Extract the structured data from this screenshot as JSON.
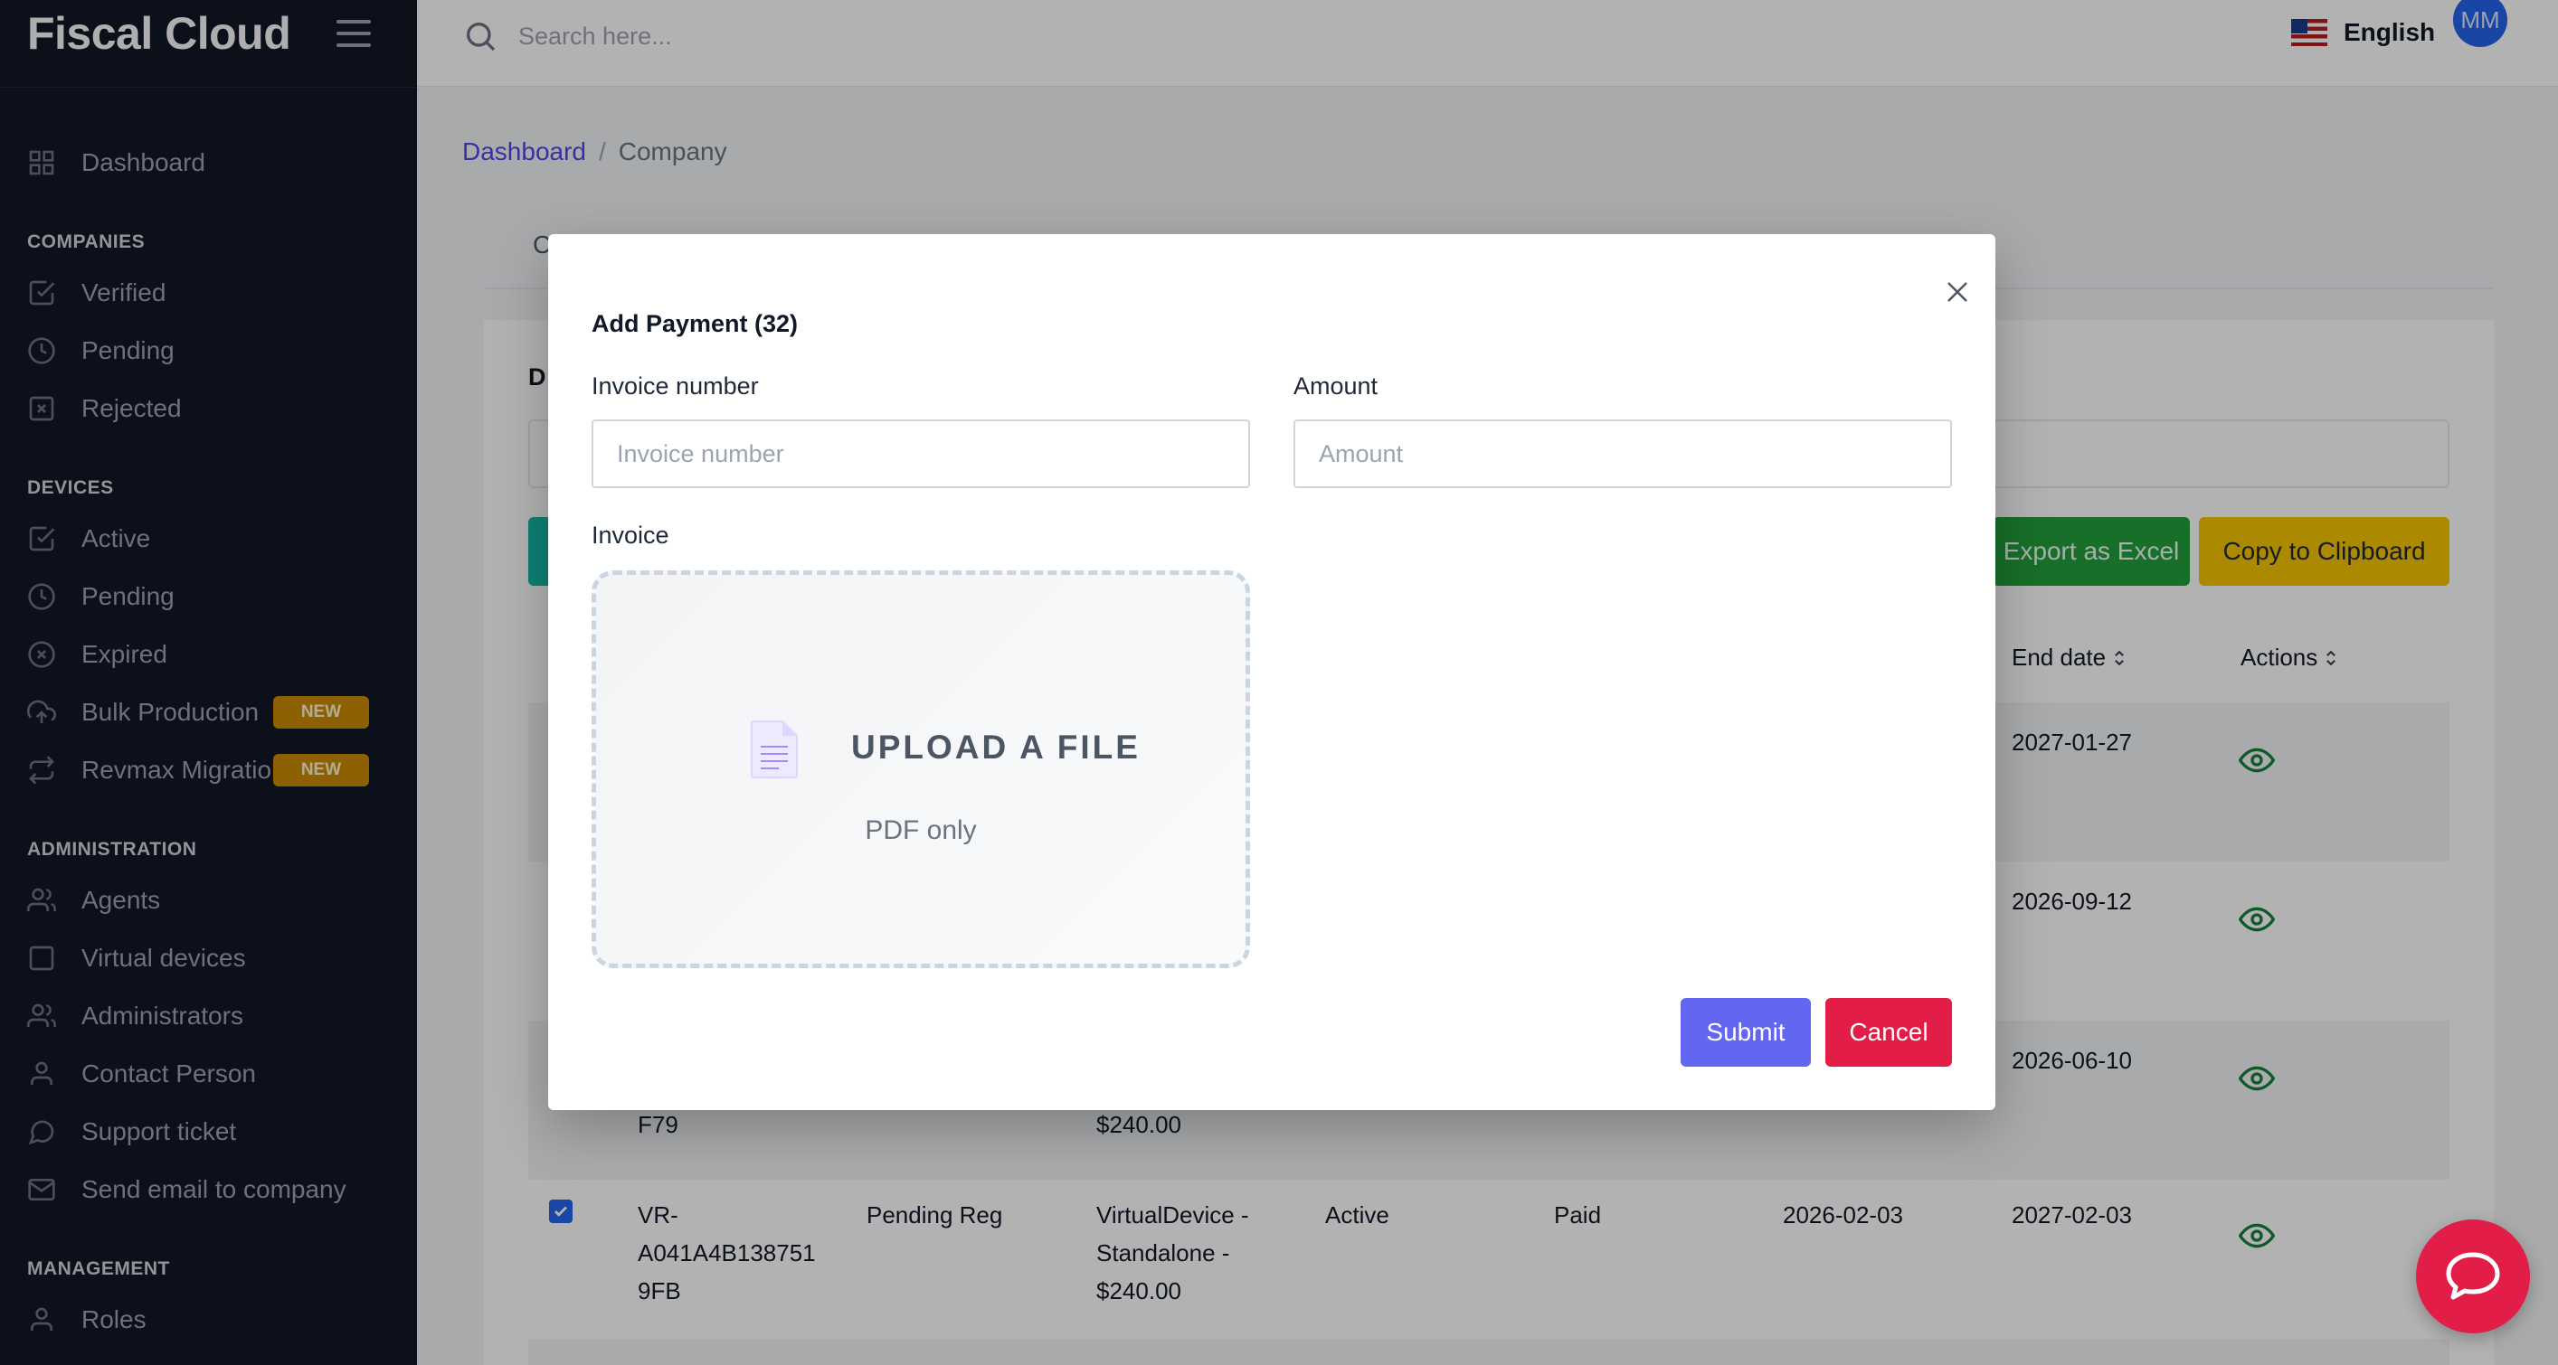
{
  "brand": "Fiscal Cloud",
  "header": {
    "search_placeholder": "Search here...",
    "language": "English",
    "avatar_initials": "MM"
  },
  "sidebar": {
    "dashboard": "Dashboard",
    "sections": {
      "companies": "COMPANIES",
      "devices": "DEVICES",
      "administration": "ADMINISTRATION",
      "management": "MANAGEMENT"
    },
    "companies": [
      "Verified",
      "Pending",
      "Rejected"
    ],
    "devices": [
      "Active",
      "Pending",
      "Expired",
      "Bulk Production",
      "Revmax Migration"
    ],
    "administration": [
      "Agents",
      "Virtual devices",
      "Administrators",
      "Contact Person",
      "Support ticket",
      "Send email to company"
    ],
    "management": [
      "Roles"
    ],
    "new_badge": "NEW"
  },
  "breadcrumb": {
    "root": "Dashboard",
    "separator": "/",
    "current": "Company"
  },
  "page": {
    "tab_peek": "C",
    "card_title_peek": "D",
    "export_excel": "Export as Excel",
    "copy_clipboard": "Copy to Clipboard",
    "columns": {
      "end_date": "End date",
      "actions": "Actions"
    },
    "rows": [
      {
        "end_date": "2027-01-27"
      },
      {
        "end_date": "2026-09-12"
      },
      {
        "id_line3": "F79",
        "price": "$240.00",
        "end_date": "2026-06-10"
      },
      {
        "id_lines": [
          "VR-",
          "A041A4B138751",
          "9FB"
        ],
        "status": "Pending Reg",
        "plan_lines": [
          "VirtualDevice -",
          "Standalone -",
          "$240.00"
        ],
        "state": "Active",
        "payment": "Paid",
        "start_date": "2026-02-03",
        "end_date": "2027-02-03"
      }
    ]
  },
  "modal": {
    "title": "Add Payment (32)",
    "invoice_number_label": "Invoice number",
    "invoice_number_placeholder": "Invoice number",
    "amount_label": "Amount",
    "amount_placeholder": "Amount",
    "invoice_label": "Invoice",
    "upload_title": "UPLOAD A FILE",
    "upload_hint": "PDF only",
    "submit": "Submit",
    "cancel": "Cancel"
  },
  "colors": {
    "sidebar_bg": "#111827",
    "primary": "#6366f1",
    "danger": "#e11d48",
    "excel": "#22a03c",
    "clipboard": "#f5c400",
    "badge": "#ca8a04"
  },
  "icons": [
    "hamburger-icon",
    "search-icon",
    "us-flag-icon",
    "close-icon",
    "document-icon",
    "eye-icon",
    "chat-icon"
  ]
}
